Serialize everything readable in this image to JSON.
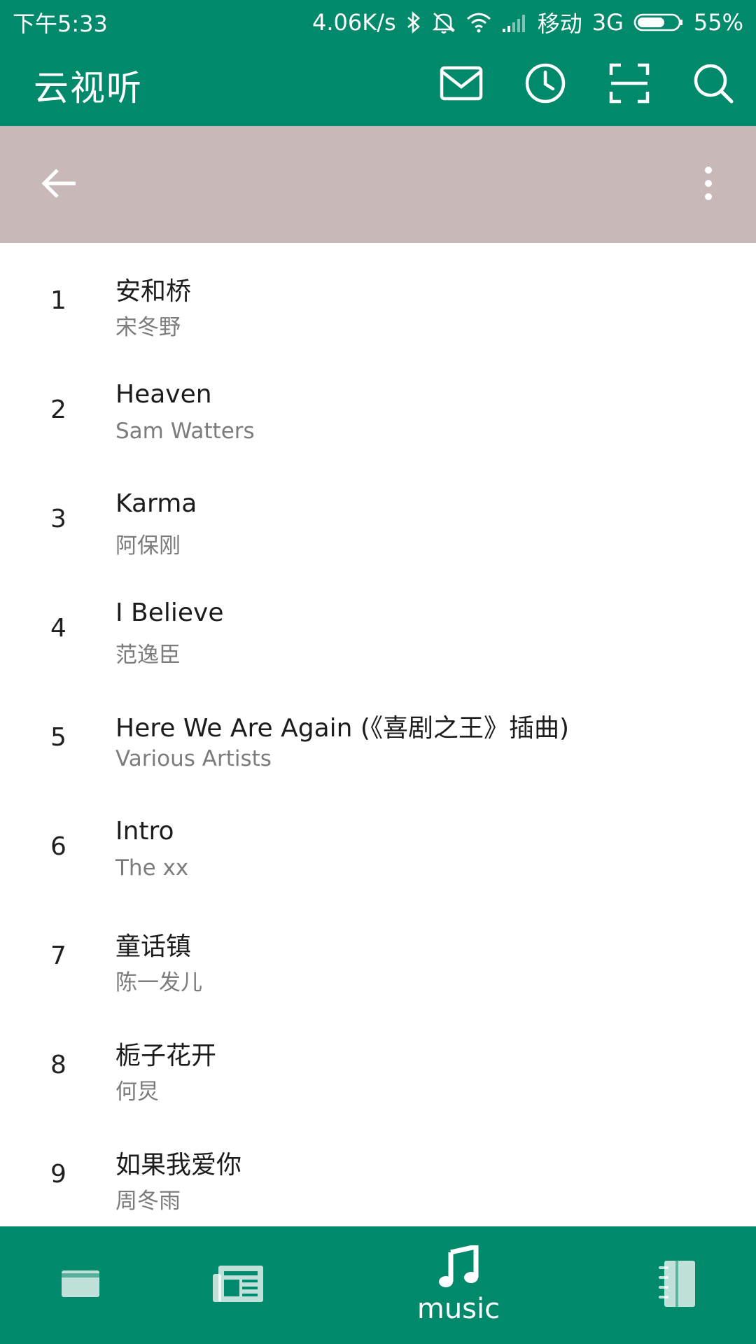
{
  "status_bar": {
    "time": "下午5:33",
    "net_speed": "4.06K/s",
    "carrier": "移动",
    "network_type": "3G",
    "battery": "55%",
    "battery_level": 0.55,
    "icons": [
      "bluetooth-icon",
      "mute-icon",
      "wifi-icon",
      "signal-icon",
      "battery-icon"
    ]
  },
  "app_bar": {
    "title": "云视听",
    "actions": [
      "mail-icon",
      "clock-icon",
      "scan-icon",
      "search-icon"
    ]
  },
  "sub_bar": {
    "left_icon": "back-arrow-icon",
    "right_icon": "more-vertical-icon"
  },
  "songs": [
    {
      "num": "1",
      "title": "安和桥",
      "artist": "宋冬野"
    },
    {
      "num": "2",
      "title": "Heaven",
      "artist": "Sam Watters"
    },
    {
      "num": "3",
      "title": "Karma",
      "artist": "阿保刚"
    },
    {
      "num": "4",
      "title": "I Believe",
      "artist": "范逸臣"
    },
    {
      "num": "5",
      "title": "Here We Are Again (《喜剧之王》插曲)",
      "artist": "Various Artists"
    },
    {
      "num": "6",
      "title": "Intro",
      "artist": "The xx"
    },
    {
      "num": "7",
      "title": "童话镇",
      "artist": "陈一发儿"
    },
    {
      "num": "8",
      "title": "栀子花开",
      "artist": "何炅"
    },
    {
      "num": "9",
      "title": "如果我爱你",
      "artist": "周冬雨"
    }
  ],
  "bottom_nav": {
    "tabs": [
      {
        "icon": "card-icon",
        "label": ""
      },
      {
        "icon": "news-icon",
        "label": ""
      },
      {
        "icon": "music-note-icon",
        "label": "music"
      },
      {
        "icon": "notebook-icon",
        "label": ""
      }
    ],
    "selected_index": 2
  },
  "colors": {
    "primary": "#00896a",
    "sub_bar": "#c8b9b8",
    "text_primary": "#1c1c1c",
    "text_secondary": "#7c7c7c"
  }
}
